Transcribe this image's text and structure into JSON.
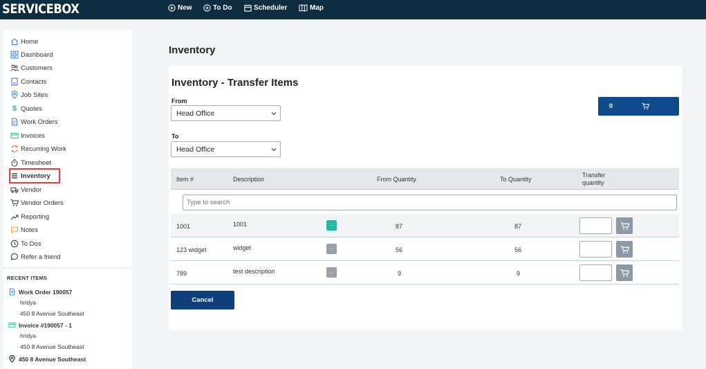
{
  "topbar": {
    "brand": "SERVICEBOX",
    "nav": [
      {
        "label": "New",
        "icon": "plus-circle-icon"
      },
      {
        "label": "To Do",
        "icon": "plus-circle-icon"
      },
      {
        "label": "Scheduler",
        "icon": "calendar-icon"
      },
      {
        "label": "Map",
        "icon": "map-icon"
      }
    ]
  },
  "sidebar": {
    "items": [
      {
        "label": "Home",
        "icon": "home-icon"
      },
      {
        "label": "Dashboard",
        "icon": "grid-icon"
      },
      {
        "label": "Customers",
        "icon": "users-icon"
      },
      {
        "label": "Contacts",
        "icon": "address-book-icon"
      },
      {
        "label": "Job Sites",
        "icon": "location-pin-icon"
      },
      {
        "label": "Quotes",
        "icon": "dollar-icon"
      },
      {
        "label": "Work Orders",
        "icon": "document-icon"
      },
      {
        "label": "Invoices",
        "icon": "invoice-icon"
      },
      {
        "label": "Recurring Work",
        "icon": "recurring-icon"
      },
      {
        "label": "Timesheet",
        "icon": "stopwatch-icon"
      },
      {
        "label": "Inventory",
        "icon": "list-icon",
        "active": true
      },
      {
        "label": "Vendor",
        "icon": "truck-icon"
      },
      {
        "label": "Vendor Orders",
        "icon": "cart-icon"
      },
      {
        "label": "Reporting",
        "icon": "trend-icon"
      },
      {
        "label": "Notes",
        "icon": "note-icon"
      },
      {
        "label": "To Dos",
        "icon": "clock-icon"
      },
      {
        "label": "Refer a friend",
        "icon": "chat-icon"
      }
    ]
  },
  "recent": {
    "title": "RECENT ITEMS",
    "items": [
      {
        "title": "Work Order 190057",
        "line1": "hridya",
        "line2": "450 8 Avenue Southeast"
      },
      {
        "title": "Invoice #190057 - 1",
        "line1": "hridya",
        "line2": "450 8 Avenue Southeast"
      },
      {
        "title": "450 8 Avenue Southeast"
      }
    ]
  },
  "page": {
    "title": "Inventory",
    "card_title": "Inventory - Transfer Items",
    "from_label": "From",
    "from_value": "Head Office",
    "to_label": "To",
    "to_value": "Head Office",
    "cart_count": "0",
    "search_placeholder": "Type to search",
    "cancel_label": "Cancel"
  },
  "table": {
    "headers": {
      "item": "Item #",
      "description": "Description",
      "from_qty": "From Quantity",
      "to_qty": "To Quantity",
      "transfer_line1": "Transfer",
      "transfer_line2": "quantity"
    },
    "rows": [
      {
        "item": "1001",
        "description": "1001",
        "from_qty": "87",
        "to_qty": "87",
        "dots": "...",
        "dots_color": "#2bb5a5"
      },
      {
        "item": "123 widget",
        "description": "widget",
        "from_qty": "56",
        "to_qty": "56",
        "dots": "...",
        "dots_color": "#9aa0a6"
      },
      {
        "item": "789",
        "description": "test description",
        "from_qty": "9",
        "to_qty": "9",
        "dots": "...",
        "dots_color": "#9aa0a6"
      }
    ]
  },
  "colors": {
    "topbar": "#0f2d40",
    "primary": "#0e4a8c",
    "active_outline": "#e04040",
    "dots_active": "#2bb5a5"
  }
}
